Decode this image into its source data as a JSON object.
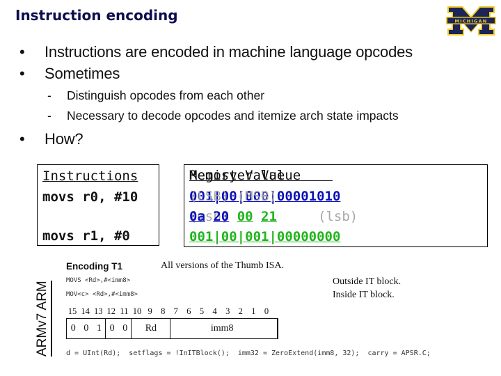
{
  "slide": {
    "title": "Instruction encoding",
    "logo": {
      "text": "MICHIGAN",
      "letter": "M",
      "colors": {
        "blue": "#1c2555",
        "maize": "#f3cd2a"
      }
    }
  },
  "bullets": [
    {
      "text": "Instructions are encoded in machine language opcodes",
      "level": 1
    },
    {
      "text": "Sometimes",
      "level": 1,
      "sub": [
        {
          "text": "Distinguish opcodes from each other"
        },
        {
          "text": "Necessary to decode opcodes and itemize arch state impacts"
        }
      ]
    },
    {
      "text": "How?",
      "level": 1
    }
  ],
  "bullet_glyph": "•",
  "dash_glyph": "-",
  "instructions_box": {
    "header": "Instructions",
    "lines": [
      "movs r0, #10",
      "movs r1, #0"
    ]
  },
  "register_box": {
    "register_header": "Register Value",
    "memory_header": "Memory Value",
    "reg_row1": {
      "parts": [
        "001",
        "00",
        "000",
        "00001010"
      ],
      "separator": "|",
      "color": "#0b10b8"
    },
    "msb_label": "(msb)",
    "lsb_label": "(lsb)",
    "reg_row2": {
      "parts": [
        "001",
        "00",
        "001",
        "00000000"
      ],
      "separator": "|",
      "color": "#1fb51a"
    },
    "mem_lsb_label": "(LSB)",
    "mem_msb_label": "(MSB)",
    "mem_bytes": [
      {
        "value": "0a",
        "color": "#0b10b8"
      },
      {
        "value": "20",
        "color": "#0b10b8"
      },
      {
        "value": "00",
        "color": "#1fb51a"
      },
      {
        "value": "21",
        "color": "#1fb51a"
      }
    ]
  },
  "arm_reference": {
    "side_label": "ARMv7 ARM",
    "encoding_title": "Encoding T1",
    "versions_note": "All versions of the Thumb ISA.",
    "syntax": [
      {
        "text": "MOVS <Rd>,#<imm8>",
        "note": "Outside IT block."
      },
      {
        "text": "MOV<c> <Rd>,#<imm8>",
        "note": "Inside IT block."
      }
    ],
    "bit_numbers": [
      "15",
      "14",
      "13",
      "12",
      "11",
      "10",
      "9",
      "8",
      "7",
      "6",
      "5",
      "4",
      "3",
      "2",
      "1",
      "0"
    ],
    "fields": [
      {
        "label": "0",
        "bits": 1
      },
      {
        "label": "0",
        "bits": 1
      },
      {
        "label": "1",
        "bits": 1
      },
      {
        "label": "0",
        "bits": 1
      },
      {
        "label": "0",
        "bits": 1
      },
      {
        "label": "Rd",
        "bits": 3
      },
      {
        "label": "imm8",
        "bits": 8
      }
    ],
    "pseudocode": "d = UInt(Rd);  setflags = !InITBlock();  imm32 = ZeroExtend(imm8, 32);  carry = APSR.C;"
  }
}
